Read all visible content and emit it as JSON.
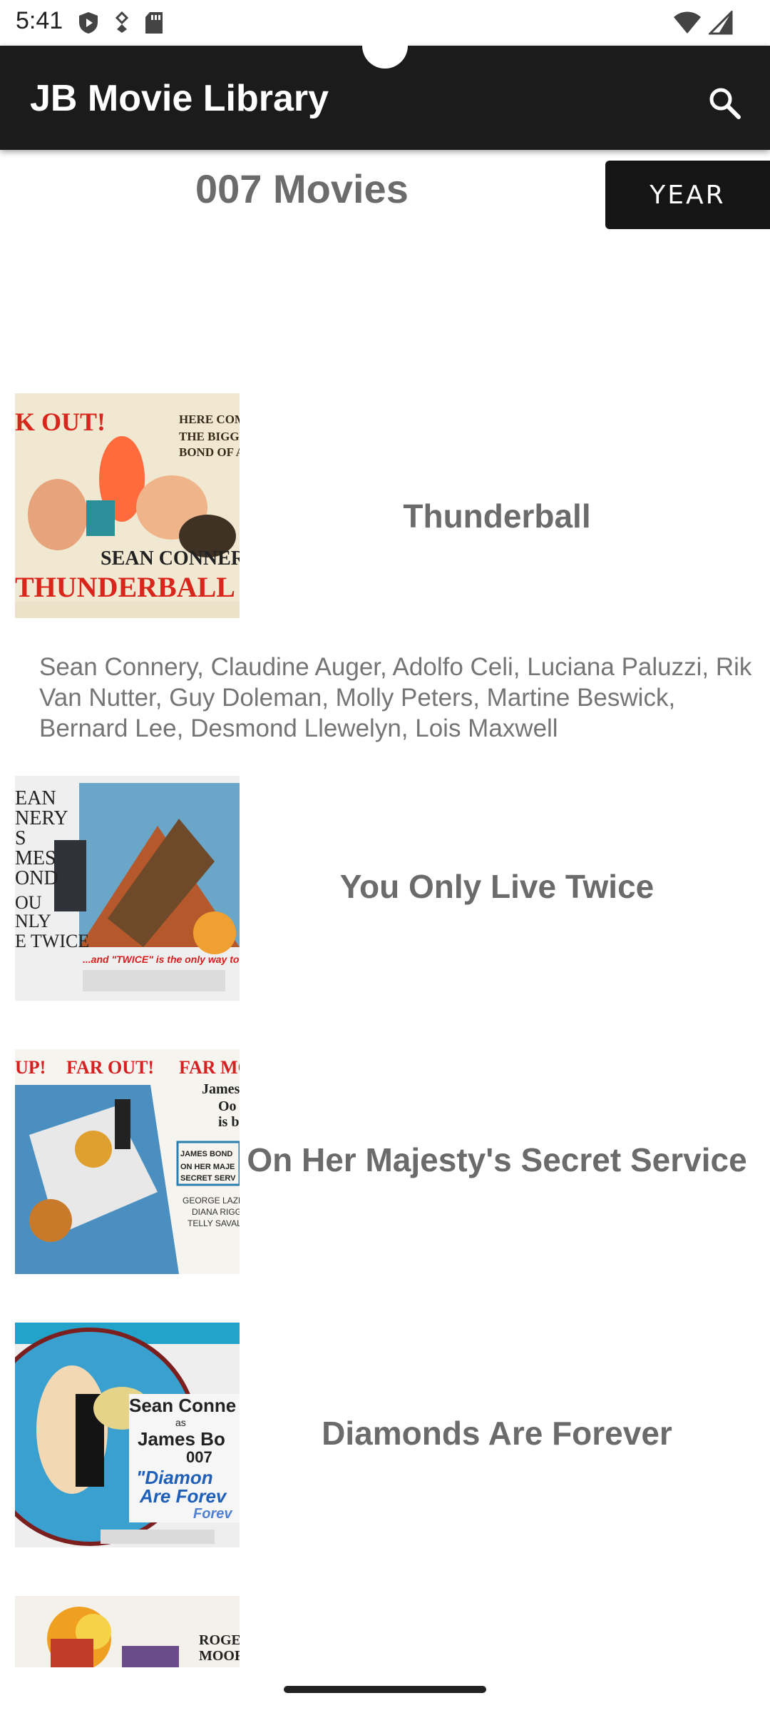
{
  "status_bar": {
    "time": "5:41",
    "left_icons": [
      "shield-icon",
      "download-icon",
      "sd-card-icon"
    ],
    "right_icons": [
      "wifi-icon",
      "signal-icon"
    ]
  },
  "app_bar": {
    "title": "JB Movie Library",
    "search_icon": "search-icon"
  },
  "header": {
    "title": "007 Movies",
    "sort_button": "YEAR"
  },
  "movies": [
    {
      "title": "Thunderball",
      "cast": "Sean Connery, Claudine Auger, Adolfo Celi, Luciana Paluzzi, Rik Van Nutter, Guy Doleman, Molly Peters, Martine Beswick, Bernard Lee, Desmond Llewelyn, Lois Maxwell",
      "poster_text": [
        "K OUT!",
        "HERE COM",
        "THE BIGGE",
        "BOND OF A",
        "SEAN CONNERY",
        "THUNDERBALL"
      ]
    },
    {
      "title": "You Only Live Twice",
      "poster_text": [
        "EAN",
        "NERY",
        "S",
        "MES",
        "OND",
        "OU",
        "NLY",
        "E TWICE",
        "...and \"TWICE\" is the only way to li"
      ]
    },
    {
      "title": "On Her Majesty's Secret Service",
      "poster_text": [
        "UP!",
        "FAR OUT!",
        "FAR MO",
        "James",
        "Oo",
        "is b",
        "JAMES BOND",
        "ON HER MAJE",
        "SECRET SERV",
        "GEORGE LAZENB",
        "DIANA RIGG",
        "TELLY SAVALAS"
      ]
    },
    {
      "title": "Diamonds Are Forever",
      "poster_text": [
        "Sean Conne",
        "as",
        "James Bo",
        "007",
        "\"Diamon",
        "Are Forev",
        "Forev"
      ]
    },
    {
      "title": "",
      "poster_text": [
        "ROGER",
        "MOORE"
      ]
    }
  ],
  "colors": {
    "app_bar": "#1b1b1b",
    "title_text": "#6b6b6b",
    "cast_text": "#757575",
    "year_button": "#151515"
  }
}
